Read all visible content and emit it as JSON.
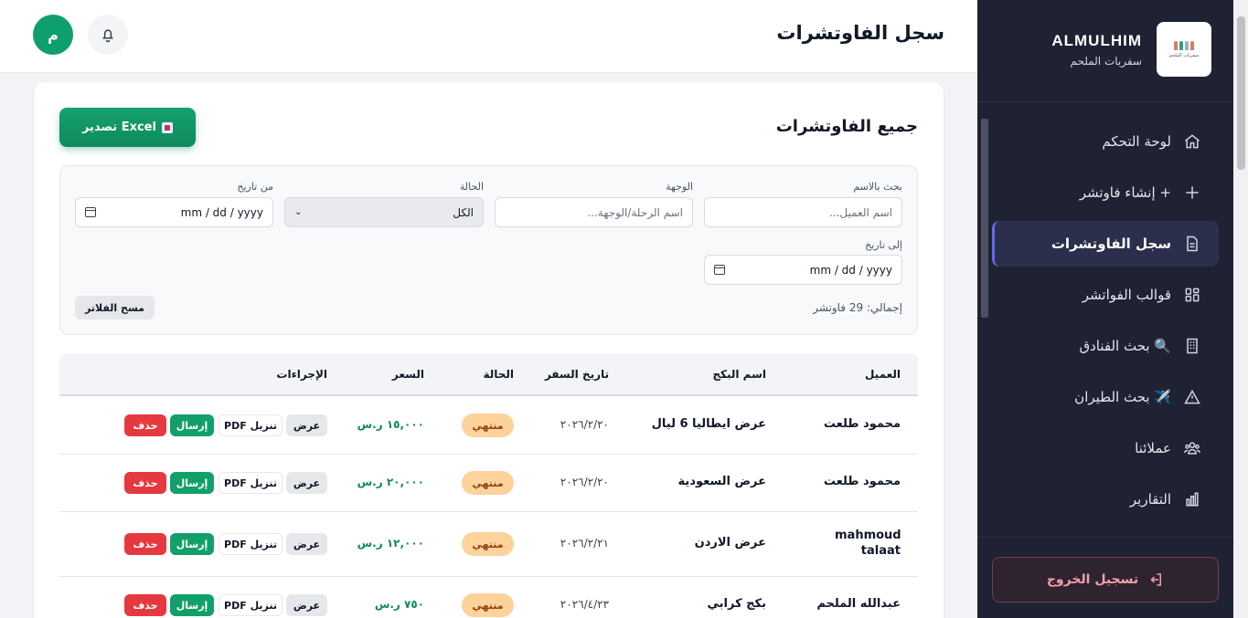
{
  "header": {
    "title": "سجل الفاوتشرات",
    "avatar_letter": "م"
  },
  "sidebar": {
    "brand_name": "ALMULHIM",
    "brand_sub": "سفريات الملحم",
    "logo_text": "سفريات الملحم",
    "items": [
      {
        "label": "لوحة التحكم",
        "icon": "home-icon"
      },
      {
        "label": "+ إنشاء فاوتشر",
        "icon": "plus-icon"
      },
      {
        "label": "سجل الفاوتشرات",
        "icon": "document-icon",
        "active": true
      },
      {
        "label": "قوالب الفواتشر",
        "icon": "grid-icon"
      },
      {
        "label": "🔍 بحث الفنادق",
        "icon": "building-icon"
      },
      {
        "label": "✈️ بحث الطيران",
        "icon": "warning-icon"
      },
      {
        "label": "عملائنا",
        "icon": "users-icon"
      },
      {
        "label": "التقارير",
        "icon": "chart-icon"
      }
    ],
    "logout_label": "تسجيل الخروج"
  },
  "main": {
    "card_title": "جميع الفاوتشرات",
    "export_label": "تصدير Excel",
    "filters": {
      "search_label": "بحث بالاسم",
      "search_placeholder": "اسم العميل...",
      "dest_label": "الوجهة",
      "dest_placeholder": "اسم الرحلة/الوجهة...",
      "status_label": "الحالة",
      "status_value": "الكل",
      "from_label": "من تاريخ",
      "to_label": "إلى تاريخ",
      "date_placeholder": "mm / dd / yyyy",
      "total_text": "إجمالي: 29 فاوتشر",
      "clear_label": "مسح الفلاتر"
    },
    "table": {
      "headers": {
        "customer": "العميل",
        "package": "اسم البكج",
        "date": "تاريخ السفر",
        "status": "الحالة",
        "price": "السعر",
        "actions": "الإجراءات"
      },
      "actions": {
        "view": "عرض",
        "pdf": "تنزيل PDF",
        "send": "إرسال",
        "delete": "حذف"
      },
      "rows": [
        {
          "customer": "محمود طلعت",
          "package": "عرض ايطاليا 6 ليال",
          "date": "٢٠٢٦/٢/٢٠",
          "status": "منتهي",
          "price": "١٥,٠٠٠ ر.س"
        },
        {
          "customer": "محمود طلعت",
          "package": "عرض السعودية",
          "date": "٢٠٢٦/٢/٢٠",
          "status": "منتهي",
          "price": "٢٠,٠٠٠ ر.س"
        },
        {
          "customer": "mahmoud talaat",
          "package": "عرض الاردن",
          "date": "٢٠٢٦/٢/٢١",
          "status": "منتهي",
          "price": "١٢,٠٠٠ ر.س"
        },
        {
          "customer": "عبدالله الملحم",
          "package": "بكج كرابي",
          "date": "٢٠٢٦/٤/٢٣",
          "status": "منتهي",
          "price": "٧٥٠ ر.س"
        }
      ]
    }
  }
}
